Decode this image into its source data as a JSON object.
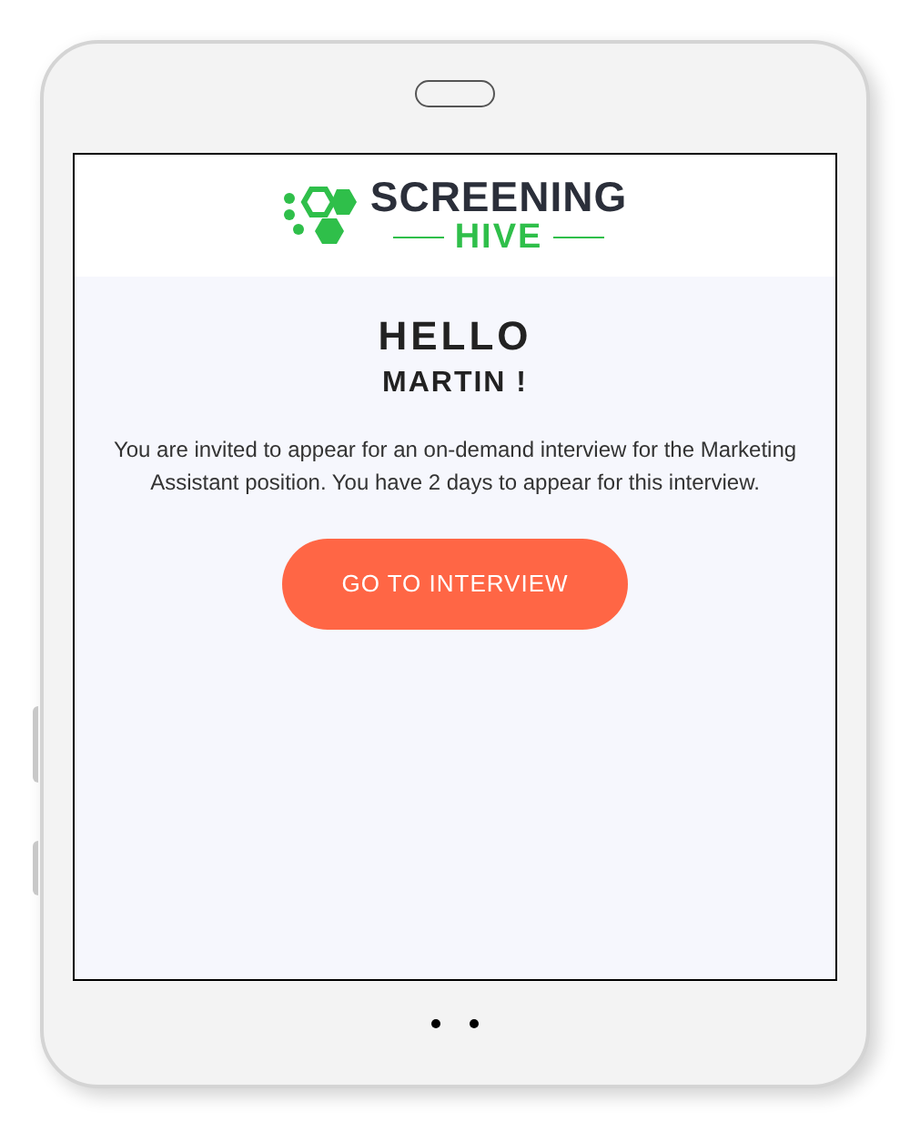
{
  "logo": {
    "word_top": "SCREENING",
    "word_bottom": "HIVE"
  },
  "greeting": {
    "title": "HELLO",
    "name": "MARTIN !"
  },
  "message": "You are invited to appear for an on-demand interview for the Marketing Assistant position. You have 2 days to appear for this interview.",
  "button": {
    "label": "GO TO INTERVIEW"
  }
}
